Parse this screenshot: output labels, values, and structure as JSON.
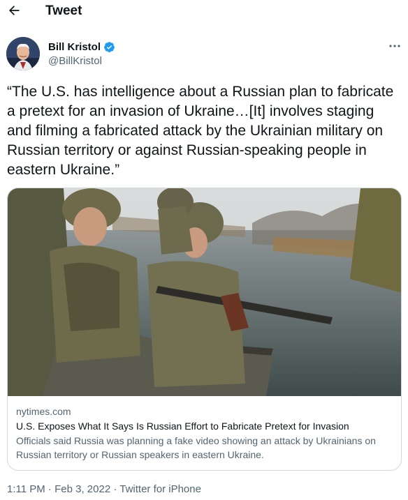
{
  "header": {
    "title": "Tweet",
    "back_icon": "arrow-left-icon"
  },
  "author": {
    "name": "Bill Kristol",
    "handle": "@BillKristol",
    "verified_icon": "verified-badge-icon",
    "verified_color": "#1d9bf0"
  },
  "more_icon": "more-horizontal-icon",
  "tweet": {
    "text": "“The U.S. has intelligence about a Russian plan to fabricate a pretext for an invasion of Ukraine…[It] involves staging and filming a fabricated attack by the Ukrainian military on Russian territory or against Russian-speaking people in eastern Ukraine.”"
  },
  "card": {
    "domain": "nytimes.com",
    "title": "U.S. Exposes What It Says Is Russian Effort to Fabricate Pretext for Invasion",
    "description": "Officials said Russia was planning a fake video showing an attack by Ukrainians on Russian territory or Russian speakers in eastern Ukraine."
  },
  "meta": {
    "time": "1:11 PM",
    "separator": "·",
    "date": "Feb 3, 2022",
    "source": "Twitter for iPhone"
  }
}
